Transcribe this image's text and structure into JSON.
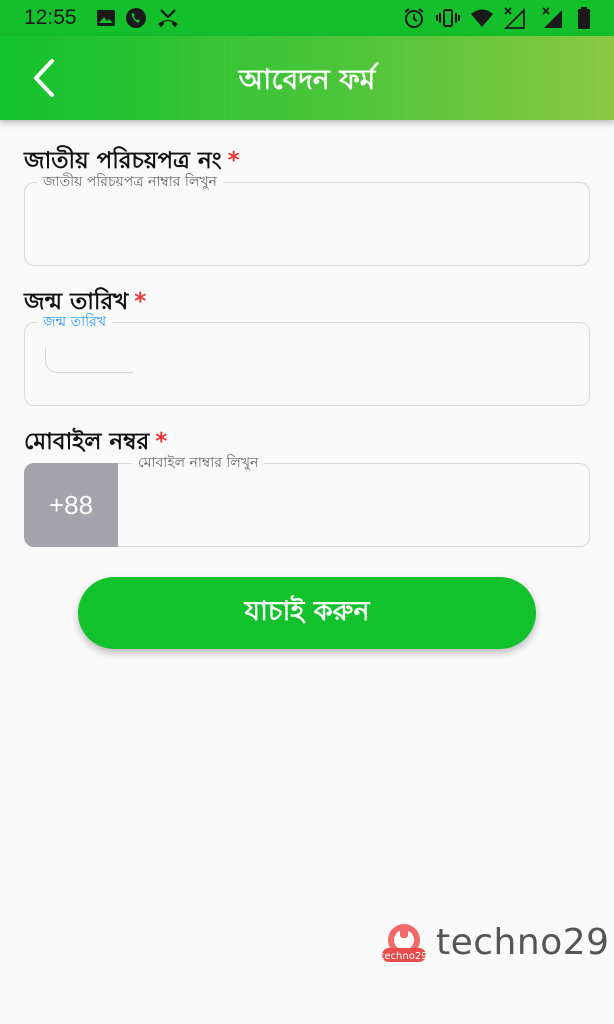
{
  "status_bar": {
    "time": "12:55",
    "left_icons": [
      "image-icon",
      "whatsapp-icon",
      "missed-call-icon"
    ],
    "right_icons": [
      "alarm-icon",
      "vibrate-icon",
      "wifi-icon",
      "signal-x-icon",
      "signal-x-icon",
      "battery-icon"
    ]
  },
  "app_bar": {
    "title": "আবেদন ফর্ম",
    "back_icon": "chevron-left-icon"
  },
  "form": {
    "nid": {
      "label": "জাতীয় পরিচয়পত্র নং",
      "required": "*",
      "placeholder": "জাতীয় পরিচয়পত্র নাম্বার লিখুন",
      "value": ""
    },
    "dob": {
      "label": "জন্ম তারিখ",
      "required": "*",
      "placeholder": "জন্ম তারিখ",
      "value": ""
    },
    "mobile": {
      "label": "মোবাইল নম্বর",
      "required": "*",
      "prefix": "+88",
      "placeholder": "মোবাইল নাম্বার লিখুন",
      "value": ""
    },
    "submit_label": "যাচাই করুন"
  },
  "brand": {
    "logo_text": "techno29",
    "badge_text": "techno29"
  },
  "colors": {
    "primary": "#12c22d",
    "appbar_gradient_end": "#8bc842",
    "required": "#e53935",
    "active_label": "#2196f3",
    "prefix_bg": "#a4a3ab"
  }
}
